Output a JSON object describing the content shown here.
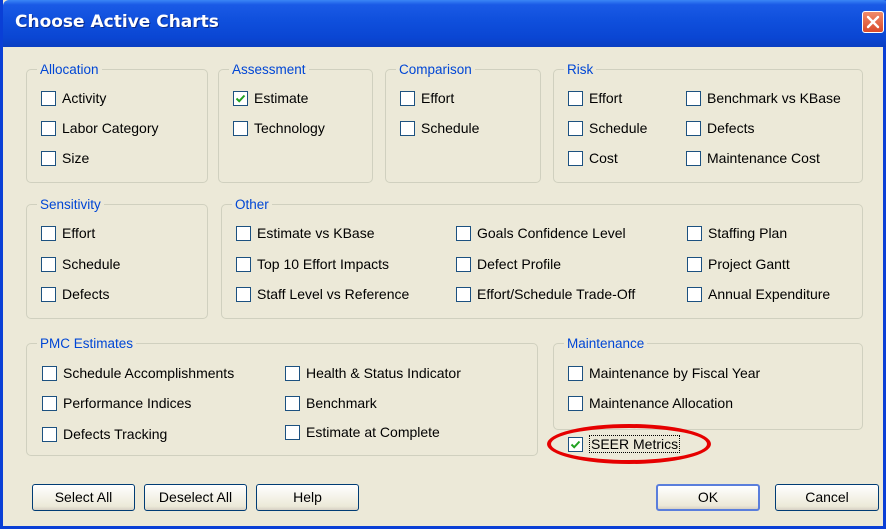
{
  "window": {
    "title": "Choose Active Charts"
  },
  "groups": {
    "allocation": {
      "title": "Allocation",
      "items": [
        {
          "label": "Activity",
          "checked": false
        },
        {
          "label": "Labor Category",
          "checked": false
        },
        {
          "label": "Size",
          "checked": false
        }
      ]
    },
    "assessment": {
      "title": "Assessment",
      "items": [
        {
          "label": "Estimate",
          "checked": true
        },
        {
          "label": "Technology",
          "checked": false
        }
      ]
    },
    "comparison": {
      "title": "Comparison",
      "items": [
        {
          "label": "Effort",
          "checked": false
        },
        {
          "label": "Schedule",
          "checked": false
        }
      ]
    },
    "risk": {
      "title": "Risk",
      "items": [
        {
          "label": "Effort",
          "checked": false
        },
        {
          "label": "Schedule",
          "checked": false
        },
        {
          "label": "Cost",
          "checked": false
        },
        {
          "label": "Benchmark vs KBase",
          "checked": false
        },
        {
          "label": "Defects",
          "checked": false
        },
        {
          "label": "Maintenance Cost",
          "checked": false
        }
      ]
    },
    "sensitivity": {
      "title": "Sensitivity",
      "items": [
        {
          "label": "Effort",
          "checked": false
        },
        {
          "label": "Schedule",
          "checked": false
        },
        {
          "label": "Defects",
          "checked": false
        }
      ]
    },
    "other": {
      "title": "Other",
      "items": [
        {
          "label": "Estimate vs KBase",
          "checked": false
        },
        {
          "label": "Top 10 Effort Impacts",
          "checked": false
        },
        {
          "label": "Staff Level vs Reference",
          "checked": false
        },
        {
          "label": "Goals Confidence Level",
          "checked": false
        },
        {
          "label": "Defect Profile",
          "checked": false
        },
        {
          "label": "Effort/Schedule Trade-Off",
          "checked": false
        },
        {
          "label": "Staffing Plan",
          "checked": false
        },
        {
          "label": "Project Gantt",
          "checked": false
        },
        {
          "label": "Annual Expenditure",
          "checked": false
        }
      ]
    },
    "pmc": {
      "title": "PMC Estimates",
      "items": [
        {
          "label": "Schedule Accomplishments",
          "checked": false
        },
        {
          "label": "Performance Indices",
          "checked": false
        },
        {
          "label": "Defects Tracking",
          "checked": false
        },
        {
          "label": "Health & Status Indicator",
          "checked": false
        },
        {
          "label": "Benchmark",
          "checked": false
        },
        {
          "label": "Estimate at Complete",
          "checked": false
        }
      ]
    },
    "maintenance": {
      "title": "Maintenance",
      "items": [
        {
          "label": "Maintenance by Fiscal Year",
          "checked": false
        },
        {
          "label": "Maintenance Allocation",
          "checked": false
        }
      ]
    }
  },
  "seer_metrics": {
    "label": "SEER Metrics",
    "checked": true
  },
  "buttons": {
    "select_all": "Select All",
    "deselect_all": "Deselect All",
    "help": "Help",
    "ok": "OK",
    "cancel": "Cancel"
  },
  "colors": {
    "highlight": "#e60000",
    "group_title": "#0046d5",
    "title_bar": "#0a46d3"
  }
}
